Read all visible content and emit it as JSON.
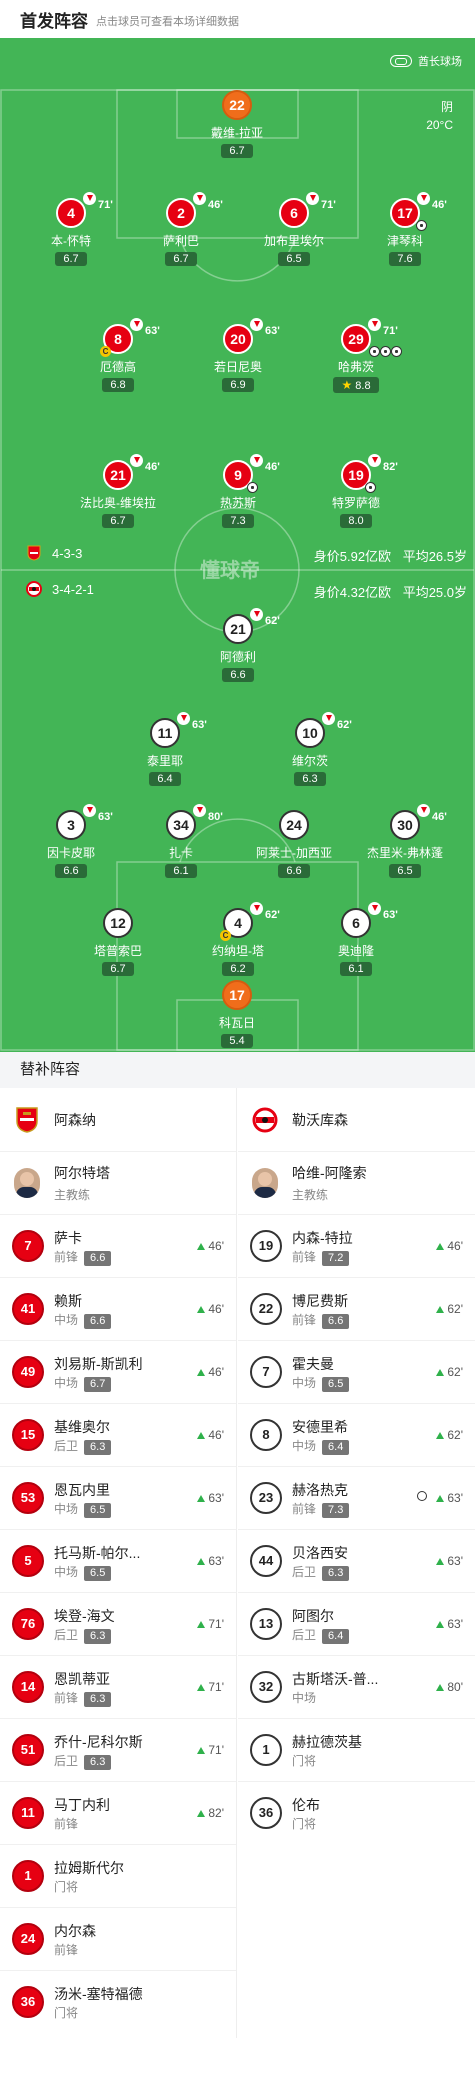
{
  "header": {
    "title": "首发阵容",
    "hint": "点击球员可查看本场详细数据"
  },
  "venue": "酋长球场",
  "weather": {
    "condition": "阴",
    "temp": "20°C"
  },
  "watermark": "懂球帝",
  "colors": {
    "pitch": "#43b556",
    "arsenal": "#e60012",
    "keeper": "#f06d1b",
    "rating_bg": "#2a6b38"
  },
  "home_team": {
    "name": "阿森纳",
    "formation": "4-3-3",
    "value": "身价5.92亿欧",
    "avg_age": "平均26.5岁"
  },
  "away_team": {
    "name": "勒沃库森",
    "formation": "3-4-2-1",
    "value": "身价4.32亿欧",
    "avg_age": "平均25.0岁"
  },
  "pitch_players": [
    {
      "num": "22",
      "name": "戴维-拉亚",
      "rating": "6.7",
      "team": "gk",
      "sub": ""
    },
    {
      "num": "4",
      "name": "本-怀特",
      "rating": "6.7",
      "team": "ars",
      "sub": "71'"
    },
    {
      "num": "2",
      "name": "萨利巴",
      "rating": "6.7",
      "team": "ars",
      "sub": "46'"
    },
    {
      "num": "6",
      "name": "加布里埃尔",
      "rating": "6.5",
      "team": "ars",
      "sub": "71'"
    },
    {
      "num": "17",
      "name": "津琴科",
      "rating": "7.6",
      "team": "ars",
      "sub": "46'"
    },
    {
      "num": "8",
      "name": "厄德高",
      "rating": "6.8",
      "team": "ars",
      "sub": "63'"
    },
    {
      "num": "20",
      "name": "若日尼奥",
      "rating": "6.9",
      "team": "ars",
      "sub": "63'"
    },
    {
      "num": "29",
      "name": "哈弗茨",
      "rating": "8.8",
      "team": "ars",
      "sub": "71'"
    },
    {
      "num": "21",
      "name": "法比奥-维埃拉",
      "rating": "6.7",
      "team": "ars",
      "sub": "46'"
    },
    {
      "num": "9",
      "name": "热苏斯",
      "rating": "7.3",
      "team": "ars",
      "sub": "46'"
    },
    {
      "num": "19",
      "name": "特罗萨德",
      "rating": "8.0",
      "team": "ars",
      "sub": "82'"
    },
    {
      "num": "21",
      "name": "阿德利",
      "rating": "6.6",
      "team": "lev",
      "sub": "62'"
    },
    {
      "num": "11",
      "name": "泰里耶",
      "rating": "6.4",
      "team": "lev",
      "sub": "63'"
    },
    {
      "num": "10",
      "name": "维尔茨",
      "rating": "6.3",
      "team": "lev",
      "sub": "62'"
    },
    {
      "num": "3",
      "name": "因卡皮耶",
      "rating": "6.6",
      "team": "lev",
      "sub": "63'"
    },
    {
      "num": "34",
      "name": "扎卡",
      "rating": "6.1",
      "team": "lev",
      "sub": "80'"
    },
    {
      "num": "24",
      "name": "阿莱士-加西亚",
      "rating": "6.6",
      "team": "lev",
      "sub": ""
    },
    {
      "num": "30",
      "name": "杰里米-弗林蓬",
      "rating": "6.5",
      "team": "lev",
      "sub": "46'"
    },
    {
      "num": "12",
      "name": "塔普索巴",
      "rating": "6.7",
      "team": "lev",
      "sub": ""
    },
    {
      "num": "4",
      "name": "约纳坦-塔",
      "rating": "6.2",
      "team": "lev",
      "sub": "62'"
    },
    {
      "num": "6",
      "name": "奥迪隆",
      "rating": "6.1",
      "team": "lev",
      "sub": "63'"
    },
    {
      "num": "17",
      "name": "科瓦日",
      "rating": "5.4",
      "team": "gk",
      "sub": ""
    }
  ],
  "subs": {
    "title": "替补阵容",
    "left_team": "阿森纳",
    "right_team": "勒沃库森",
    "left_coach": {
      "name": "阿尔特塔",
      "role": "主教练"
    },
    "right_coach": {
      "name": "哈维-阿隆索",
      "role": "主教练"
    },
    "left": [
      {
        "num": "7",
        "name": "萨卡",
        "pos": "前锋",
        "rating": "6.6",
        "in": "46'"
      },
      {
        "num": "41",
        "name": "赖斯",
        "pos": "中场",
        "rating": "6.6",
        "in": "46'"
      },
      {
        "num": "49",
        "name": "刘易斯-斯凯利",
        "pos": "中场",
        "rating": "6.7",
        "in": "46'"
      },
      {
        "num": "15",
        "name": "基维奥尔",
        "pos": "后卫",
        "rating": "6.3",
        "in": "46'"
      },
      {
        "num": "53",
        "name": "恩瓦内里",
        "pos": "中场",
        "rating": "6.5",
        "in": "63'"
      },
      {
        "num": "5",
        "name": "托马斯-帕尔...",
        "pos": "中场",
        "rating": "6.5",
        "in": "63'"
      },
      {
        "num": "76",
        "name": "埃登-海文",
        "pos": "后卫",
        "rating": "6.3",
        "in": "71'"
      },
      {
        "num": "14",
        "name": "恩凯蒂亚",
        "pos": "前锋",
        "rating": "6.3",
        "in": "71'"
      },
      {
        "num": "51",
        "name": "乔什-尼科尔斯",
        "pos": "后卫",
        "rating": "6.3",
        "in": "71'"
      },
      {
        "num": "11",
        "name": "马丁内利",
        "pos": "前锋",
        "rating": "",
        "in": "82'"
      },
      {
        "num": "1",
        "name": "拉姆斯代尔",
        "pos": "门将",
        "rating": "",
        "in": ""
      },
      {
        "num": "24",
        "name": "内尔森",
        "pos": "前锋",
        "rating": "",
        "in": ""
      },
      {
        "num": "36",
        "name": "汤米-塞特福德",
        "pos": "门将",
        "rating": "",
        "in": ""
      }
    ],
    "right": [
      {
        "num": "19",
        "name": "内森-特拉",
        "pos": "前锋",
        "rating": "7.2",
        "in": "46'"
      },
      {
        "num": "22",
        "name": "博尼费斯",
        "pos": "前锋",
        "rating": "6.6",
        "in": "62'"
      },
      {
        "num": "7",
        "name": "霍夫曼",
        "pos": "中场",
        "rating": "6.5",
        "in": "62'"
      },
      {
        "num": "8",
        "name": "安德里希",
        "pos": "中场",
        "rating": "6.4",
        "in": "62'"
      },
      {
        "num": "23",
        "name": "赫洛热克",
        "pos": "前锋",
        "rating": "7.3",
        "in": "63'",
        "goal": true
      },
      {
        "num": "44",
        "name": "贝洛西安",
        "pos": "后卫",
        "rating": "6.3",
        "in": "63'"
      },
      {
        "num": "13",
        "name": "阿图尔",
        "pos": "后卫",
        "rating": "6.4",
        "in": "63'"
      },
      {
        "num": "32",
        "name": "古斯塔沃-普...",
        "pos": "中场",
        "rating": "",
        "in": "80'"
      },
      {
        "num": "1",
        "name": "赫拉德茨基",
        "pos": "门将",
        "rating": "",
        "in": ""
      },
      {
        "num": "36",
        "name": "伦布",
        "pos": "门将",
        "rating": "",
        "in": ""
      }
    ]
  }
}
